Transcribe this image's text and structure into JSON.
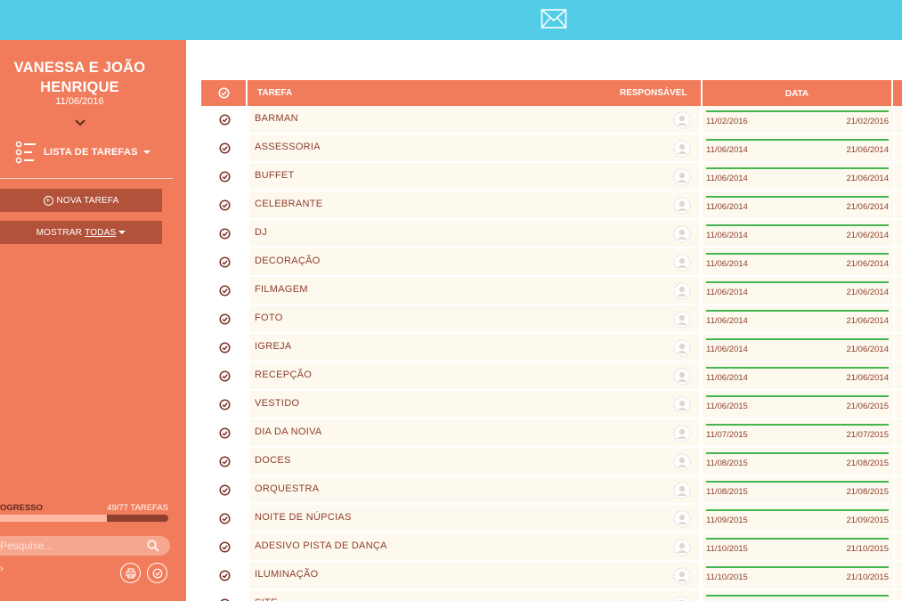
{
  "header": {
    "icon": "mail-icon"
  },
  "sidebar": {
    "couple_name": "VANESSA E JOÃO HENRIQUE",
    "wedding_date": "11/06/2016",
    "list_menu_label": "LISTA DE TAREFAS",
    "new_task_label": "NOVA TAREFA",
    "show_label": "MOSTRAR",
    "show_value": "TODAS",
    "progress_label": "OGRESSO",
    "progress_count": "49/77 TAREFAS",
    "progress_fraction": 0.636,
    "search_placeholder": "Pesquise..."
  },
  "table": {
    "col_task": "TAREFA",
    "col_responsible": "RESPONSÁVEL",
    "col_date": "DATA",
    "rows": [
      {
        "task": "BARMAN",
        "start": "11/02/2016",
        "end": "21/02/2016"
      },
      {
        "task": "ASSESSORIA",
        "start": "11/06/2014",
        "end": "21/06/2014"
      },
      {
        "task": "BUFFET",
        "start": "11/06/2014",
        "end": "21/06/2014"
      },
      {
        "task": "CELEBRANTE",
        "start": "11/06/2014",
        "end": "21/06/2014"
      },
      {
        "task": "DJ",
        "start": "11/06/2014",
        "end": "21/06/2014"
      },
      {
        "task": "DECORAÇÃO",
        "start": "11/06/2014",
        "end": "21/06/2014"
      },
      {
        "task": "FILMAGEM",
        "start": "11/06/2014",
        "end": "21/06/2014"
      },
      {
        "task": "FOTO",
        "start": "11/06/2014",
        "end": "21/06/2014"
      },
      {
        "task": "IGREJA",
        "start": "11/06/2014",
        "end": "21/06/2014"
      },
      {
        "task": "RECEPÇÃO",
        "start": "11/06/2014",
        "end": "21/06/2014"
      },
      {
        "task": "VESTIDO",
        "start": "11/06/2015",
        "end": "21/06/2015"
      },
      {
        "task": "DIA DA NOIVA",
        "start": "11/07/2015",
        "end": "21/07/2015"
      },
      {
        "task": "DOCES",
        "start": "11/08/2015",
        "end": "21/08/2015"
      },
      {
        "task": "ORQUESTRA",
        "start": "11/08/2015",
        "end": "21/08/2015"
      },
      {
        "task": "NOITE DE NÚPCIAS",
        "start": "11/09/2015",
        "end": "21/09/2015"
      },
      {
        "task": "ADESIVO PISTA DE DANÇA",
        "start": "11/10/2015",
        "end": "21/10/2015"
      },
      {
        "task": "ILUMINAÇÃO",
        "start": "11/10/2015",
        "end": "21/10/2015"
      },
      {
        "task": "SITE",
        "start": "",
        "end": ""
      }
    ]
  },
  "colors": {
    "topbar": "#52cde5",
    "accent": "#f17c5b",
    "button": "#b2523a",
    "row_bg": "#fef9ee",
    "text": "#8c3d2c",
    "date_line": "#44b54f"
  }
}
